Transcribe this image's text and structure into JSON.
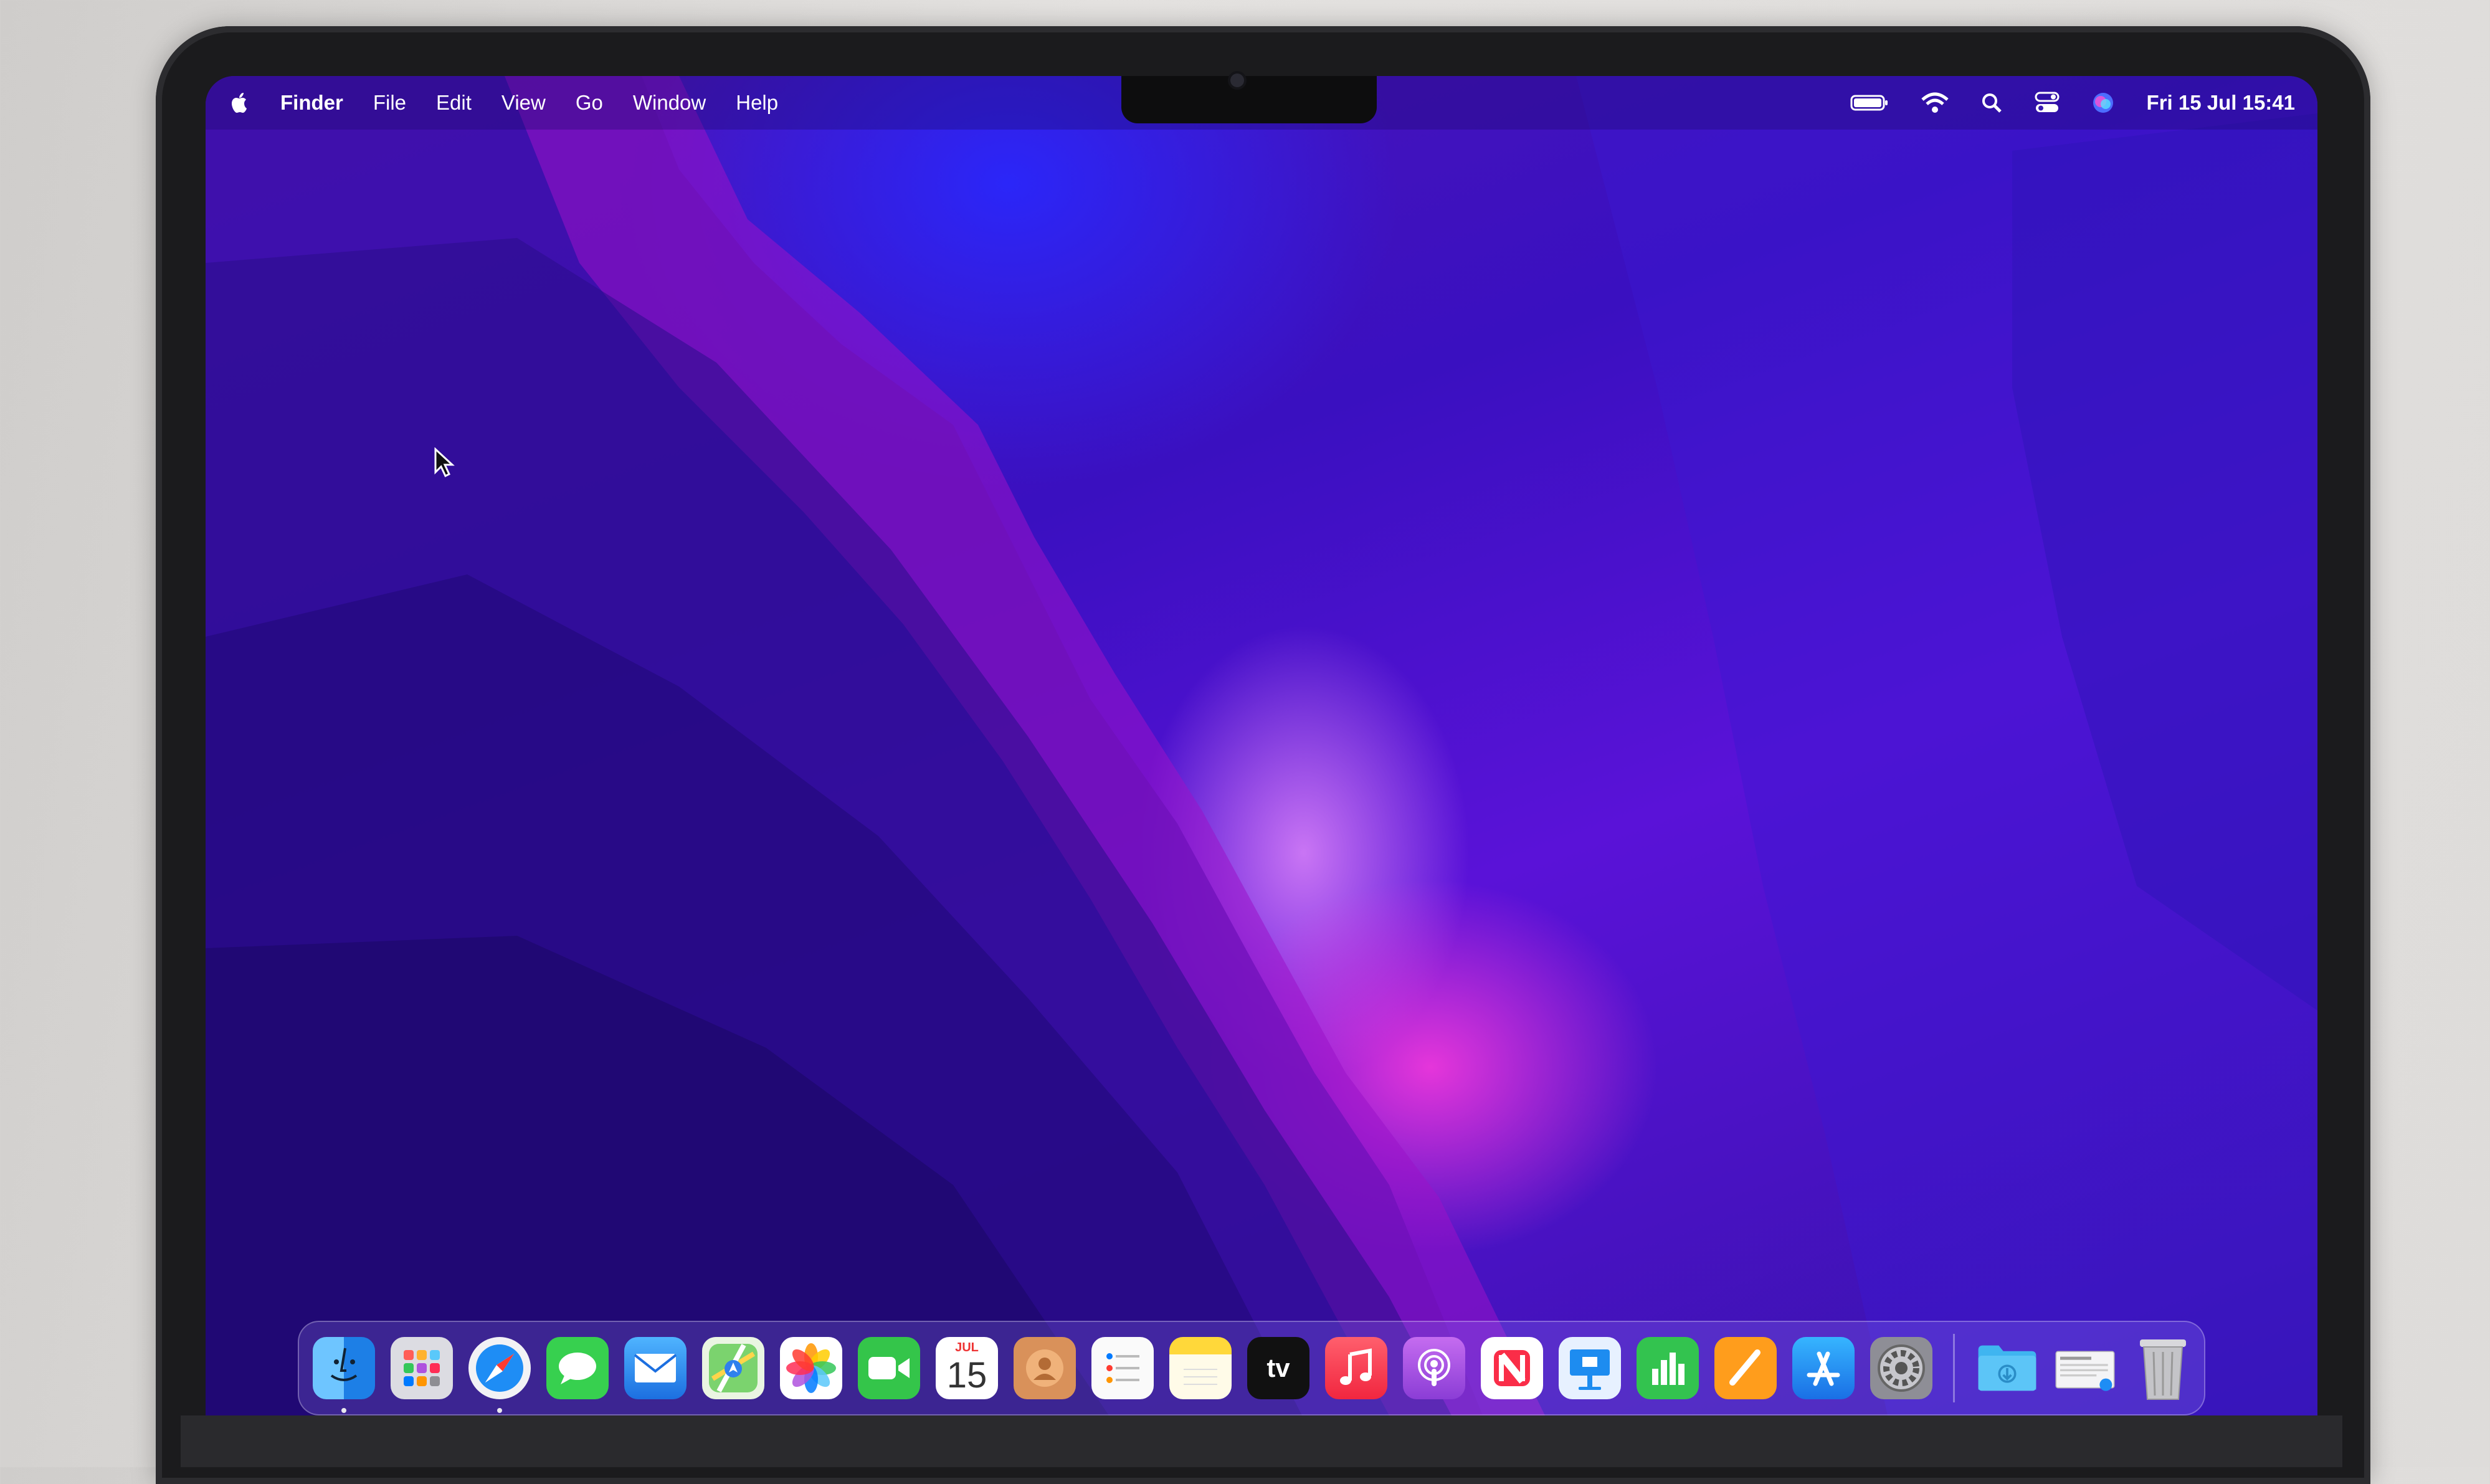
{
  "menubar": {
    "apple_icon": "apple-logo-icon",
    "items": [
      "Finder",
      "File",
      "Edit",
      "View",
      "Go",
      "Window",
      "Help"
    ],
    "status_icons": [
      "battery-icon",
      "wifi-icon",
      "spotlight-search-icon",
      "control-center-icon",
      "siri-icon"
    ],
    "clock": "Fri 15 Jul  15:41"
  },
  "dock": {
    "apps": [
      {
        "name": "Finder",
        "icon": "finder-icon",
        "color": "#2f9bf0",
        "running": true
      },
      {
        "name": "Launchpad",
        "icon": "launchpad-icon",
        "color": "#d9d9df",
        "running": false
      },
      {
        "name": "Safari",
        "icon": "safari-icon",
        "color": "#1e8df5",
        "running": true
      },
      {
        "name": "Messages",
        "icon": "messages-icon",
        "color": "#37d04f",
        "running": false
      },
      {
        "name": "Mail",
        "icon": "mail-icon",
        "color": "#2b8ff0",
        "running": false
      },
      {
        "name": "Maps",
        "icon": "maps-icon",
        "color": "#6dcf6a",
        "running": false
      },
      {
        "name": "Photos",
        "icon": "photos-icon",
        "color": "#ffffff",
        "running": false
      },
      {
        "name": "FaceTime",
        "icon": "facetime-icon",
        "color": "#34c54a",
        "running": false
      },
      {
        "name": "Calendar",
        "icon": "calendar-icon",
        "color": "#ffffff",
        "running": false,
        "month": "JUL",
        "day": "15"
      },
      {
        "name": "Contacts",
        "icon": "contacts-icon",
        "color": "#d9915a",
        "running": false
      },
      {
        "name": "Reminders",
        "icon": "reminders-icon",
        "color": "#fafafa",
        "running": false
      },
      {
        "name": "Notes",
        "icon": "notes-icon",
        "color": "#ffd83a",
        "running": false
      },
      {
        "name": "TV",
        "icon": "apple-tv-icon",
        "color": "#111111",
        "running": false,
        "label": "tv"
      },
      {
        "name": "Music",
        "icon": "music-icon",
        "color": "#f43a53",
        "running": false
      },
      {
        "name": "Podcasts",
        "icon": "podcasts-icon",
        "color": "#a64ae0",
        "running": false
      },
      {
        "name": "News",
        "icon": "news-icon",
        "color": "#ffffff",
        "running": false
      },
      {
        "name": "Keynote",
        "icon": "keynote-icon",
        "color": "#1d8cf0",
        "running": false
      },
      {
        "name": "Numbers",
        "icon": "numbers-icon",
        "color": "#33c34f",
        "running": false
      },
      {
        "name": "Pages",
        "icon": "pages-icon",
        "color": "#ff9d1c",
        "running": false
      },
      {
        "name": "App Store",
        "icon": "app-store-icon",
        "color": "#1f8ef5",
        "running": false
      },
      {
        "name": "System Preferences",
        "icon": "system-preferences-icon",
        "color": "#9a9aa2",
        "running": false
      }
    ],
    "stacks": [
      {
        "name": "Downloads",
        "icon": "downloads-folder-icon",
        "color": "#3fb5f0"
      },
      {
        "name": "Recent Document",
        "icon": "document-stack-icon",
        "color": "#f4f4f6"
      },
      {
        "name": "Trash",
        "icon": "trash-icon",
        "color": "#c8c8cc"
      }
    ]
  }
}
